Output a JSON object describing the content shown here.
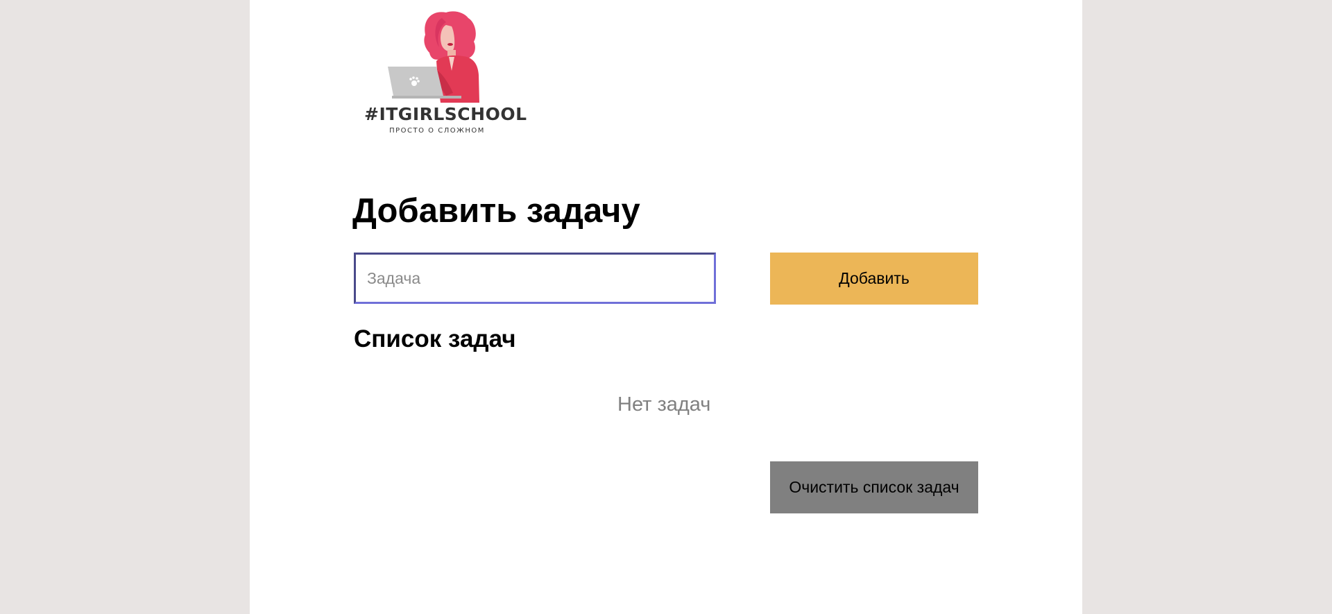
{
  "logo": {
    "title": "#ITGIRLSCHOOL",
    "subtitle": "ПРОСТО О СЛОЖНОМ",
    "colors": {
      "hair": "#e8456a",
      "jacket": "#e23a55",
      "laptop": "#c8c8c8",
      "skin": "#f4c2b8"
    }
  },
  "form": {
    "heading": "Добавить задачу",
    "input_placeholder": "Задача",
    "input_value": "",
    "add_label": "Добавить"
  },
  "list": {
    "heading": "Список задач",
    "empty_text": "Нет задач",
    "clear_label": "Очистить список задач"
  },
  "colors": {
    "background": "#e8e4e3",
    "card": "#ffffff",
    "add_button": "#ecb657",
    "clear_button": "#808080",
    "input_border": "#6f6fd8"
  }
}
